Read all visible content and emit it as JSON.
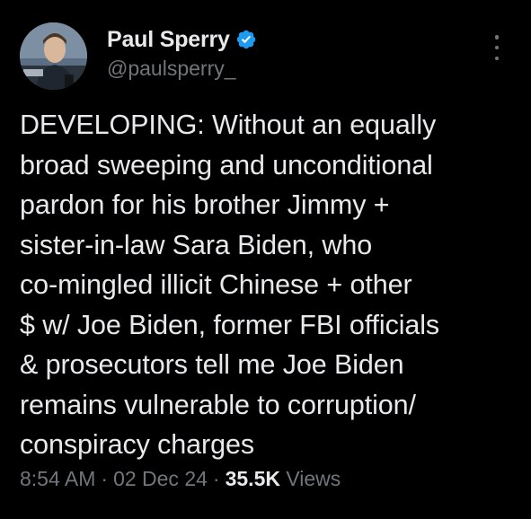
{
  "author": {
    "display_name": "Paul Sperry",
    "handle": "@paulsperry_",
    "verified": true,
    "verified_icon": "verified-badge-icon",
    "accent_color": "#1d9bf0"
  },
  "tweet": {
    "lines": [
      "DEVELOPING: Without an equally",
      "broad sweeping and unconditional",
      "pardon for his brother Jimmy +",
      "sister-in-law Sara Biden, who",
      "co-mingled illicit Chinese + other",
      "$ w/ Joe Biden, former FBI officials",
      "& prosecutors tell me Joe Biden",
      "remains vulnerable to corruption/",
      "conspiracy charges"
    ]
  },
  "meta": {
    "time": "8:54 AM",
    "separator": "·",
    "date": "02 Dec 24",
    "views_count": "35.5K",
    "views_label": "Views"
  },
  "menu": {
    "icon": "more-vertical-icon"
  }
}
